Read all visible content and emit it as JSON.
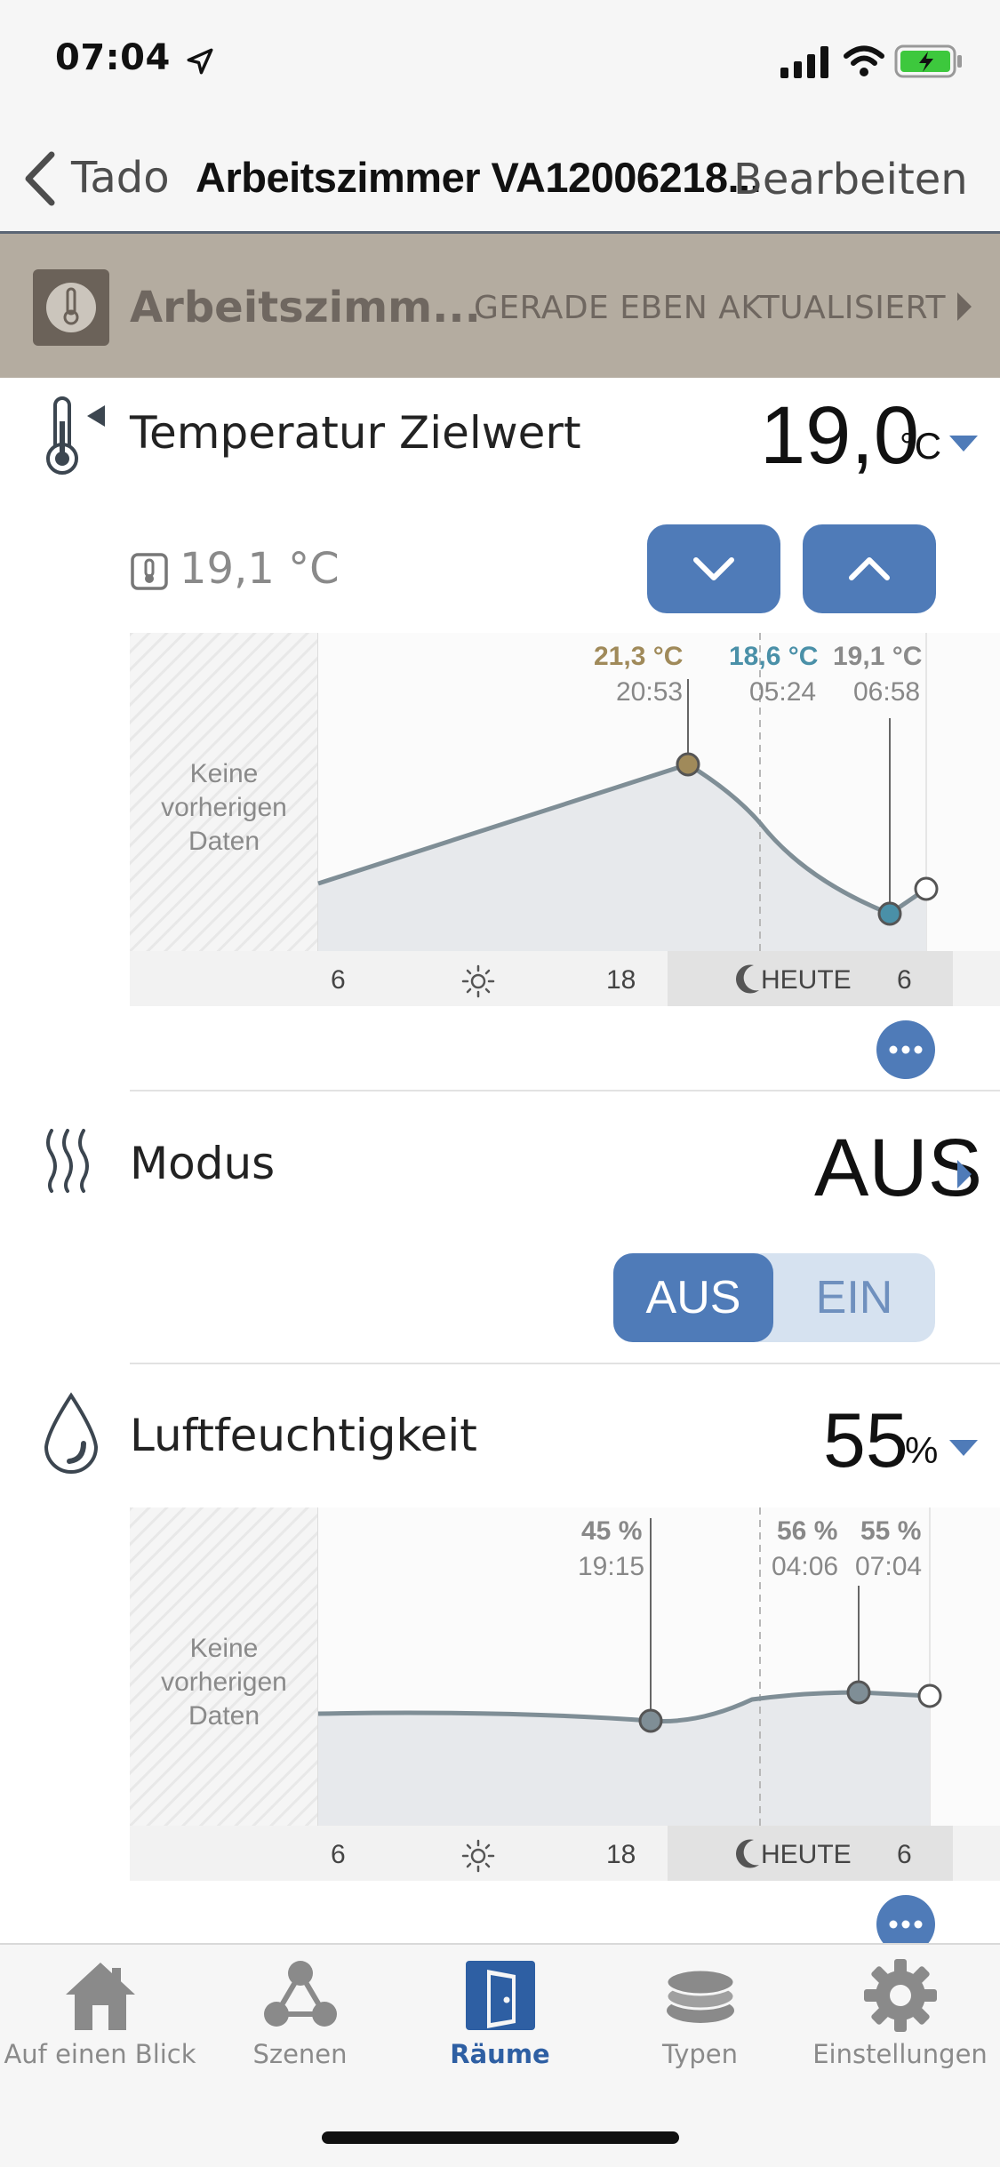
{
  "status": {
    "time": "07:04"
  },
  "nav": {
    "back_label": "Tado",
    "title": "Arbeitszimmer VA12006218...",
    "edit_label": "Bearbeiten"
  },
  "device": {
    "name": "Arbeitszimm...",
    "status": "GERADE EBEN AKTUALISIERT"
  },
  "temperature": {
    "label": "Temperatur Zielwert",
    "value": "19,0",
    "unit": "°C",
    "current": "19,1 °C",
    "chart": {
      "no_data": "Keine vorherigen Daten",
      "annotations": [
        {
          "value": "21,3 °C",
          "time": "20:53",
          "color": "#a08a5a"
        },
        {
          "value": "18,6 °C",
          "time": "05:24",
          "color": "#4a90a8"
        },
        {
          "value": "19,1 °C",
          "time": "06:58",
          "color": "#8a8a8a"
        }
      ],
      "axis": {
        "tick1": "6",
        "tick2": "18",
        "today": "HEUTE",
        "tick3": "6"
      }
    }
  },
  "mode": {
    "label": "Modus",
    "value": "AUS",
    "toggle_off": "AUS",
    "toggle_on": "EIN"
  },
  "humidity": {
    "label": "Luftfeuchtigkeit",
    "value": "55",
    "unit": "%",
    "chart": {
      "no_data": "Keine vorherigen Daten",
      "annotations": [
        {
          "value": "45 %",
          "time": "19:15",
          "color": "#888888"
        },
        {
          "value": "56 %",
          "time": "04:06",
          "color": "#888888"
        },
        {
          "value": "55 %",
          "time": "07:04",
          "color": "#888888"
        }
      ],
      "axis": {
        "tick1": "6",
        "tick2": "18",
        "today": "HEUTE",
        "tick3": "6"
      }
    }
  },
  "tabs": [
    {
      "label": "Auf einen Blick",
      "icon": "house-icon",
      "active": false
    },
    {
      "label": "Szenen",
      "icon": "scenes-icon",
      "active": false
    },
    {
      "label": "Räume",
      "icon": "door-icon",
      "active": true
    },
    {
      "label": "Typen",
      "icon": "layers-icon",
      "active": false
    },
    {
      "label": "Einstellungen",
      "icon": "gear-icon",
      "active": false
    }
  ],
  "colors": {
    "accent": "#4f7bb8",
    "device_bar": "#b4aca0",
    "chart_line": "#7f8e96"
  }
}
